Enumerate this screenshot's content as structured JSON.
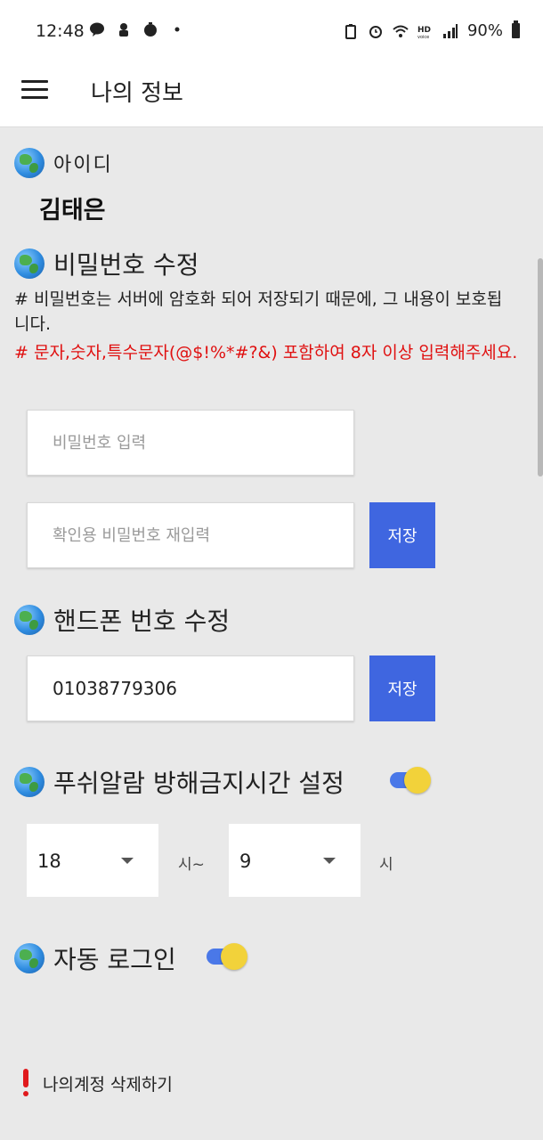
{
  "status_bar": {
    "time": "12:48",
    "battery_percent": "90%",
    "icons": [
      "kakaotalk-icon",
      "app-icon",
      "timer-icon",
      "dot-icon",
      "battery-saver-icon",
      "alarm-icon",
      "wifi-icon",
      "hd-voice-icon",
      "signal-icon",
      "battery-icon"
    ]
  },
  "app_bar": {
    "title": "나의 정보"
  },
  "id_section": {
    "label": "아이디",
    "value": "김태은"
  },
  "password_section": {
    "title": "비밀번호 수정",
    "info": "# 비밀번호는 서버에 암호화 되어 저장되기 때문에, 그 내용이 보호됩니다.",
    "warning": "# 문자,숫자,특수문자(@$!%*#?&) 포함하여 8자 이상 입력해주세요.",
    "password_placeholder": "비밀번호 입력",
    "confirm_placeholder": "확인용 비밀번호 재입력",
    "save_label": "저장"
  },
  "phone_section": {
    "title": "핸드폰 번호 수정",
    "phone_value": "01038779306",
    "save_label": "저장"
  },
  "push_section": {
    "title": "푸쉬알람 방해금지시간 설정",
    "enabled": true,
    "start_hour": "18",
    "start_unit": "시~",
    "end_hour": "9",
    "end_unit": "시"
  },
  "autologin_section": {
    "title": "자동 로그인",
    "enabled": true
  },
  "delete_account": {
    "label": "나의계정 삭제하기"
  },
  "colors": {
    "accent": "#3f66e0",
    "warning": "#e01010",
    "toggle_knob": "#f2d23a",
    "background": "#e9e9e9"
  }
}
